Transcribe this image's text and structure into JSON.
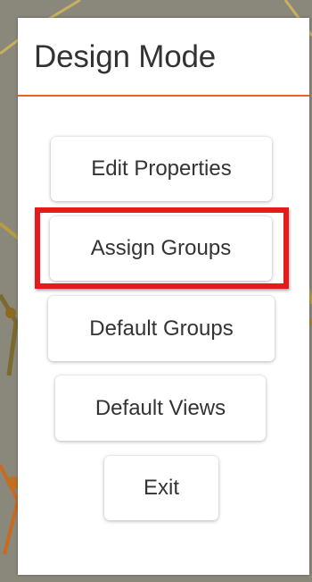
{
  "panel": {
    "title": "Design Mode",
    "accent_color": "#e8622a"
  },
  "buttons": {
    "edit_properties": "Edit Properties",
    "assign_groups": "Assign Groups",
    "default_groups": "Default Groups",
    "default_views": "Default Views",
    "exit": "Exit"
  },
  "highlight": {
    "target": "assign-groups-button",
    "color": "#e41a1c"
  }
}
